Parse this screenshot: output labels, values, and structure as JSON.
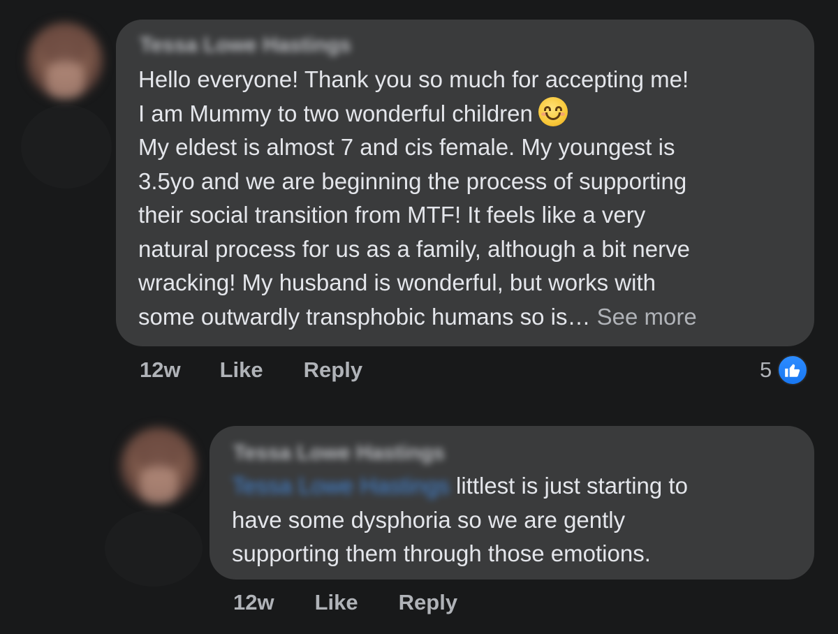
{
  "comments": [
    {
      "author": "Tessa Lowe Hastings",
      "lines": [
        "Hello everyone! Thank you so much for accepting me!",
        "I am Mummy to two wonderful children",
        "My eldest is almost 7 and cis female. My youngest is",
        "3.5yo and we are beginning the process of supporting",
        "their social transition from MTF! It feels like a very",
        "natural process for us as a family, although a bit nerve",
        "wracking! My husband is wonderful, but works with",
        "some outwardly transphobic humans so is…"
      ],
      "see_more": "See more",
      "emoji": "smiling-face-with-smiling-eyes",
      "time": "12w",
      "like_label": "Like",
      "reply_label": "Reply",
      "reaction_count": "5",
      "reaction_icon": "thumbs-up-icon"
    },
    {
      "author": "Tessa Lowe Hastings",
      "mention": "Tessa Lowe Hastings",
      "lines": [
        " littlest is just starting to",
        "have some dysphoria so we are gently",
        "supporting them through those emotions."
      ],
      "time": "12w",
      "like_label": "Like",
      "reply_label": "Reply"
    }
  ],
  "colors": {
    "background": "#18191a",
    "bubble": "#3a3b3c",
    "text": "#e4e6eb",
    "secondary_text": "#b0b3b8",
    "mention": "#4599ff",
    "like_blue": "#1877f2"
  }
}
